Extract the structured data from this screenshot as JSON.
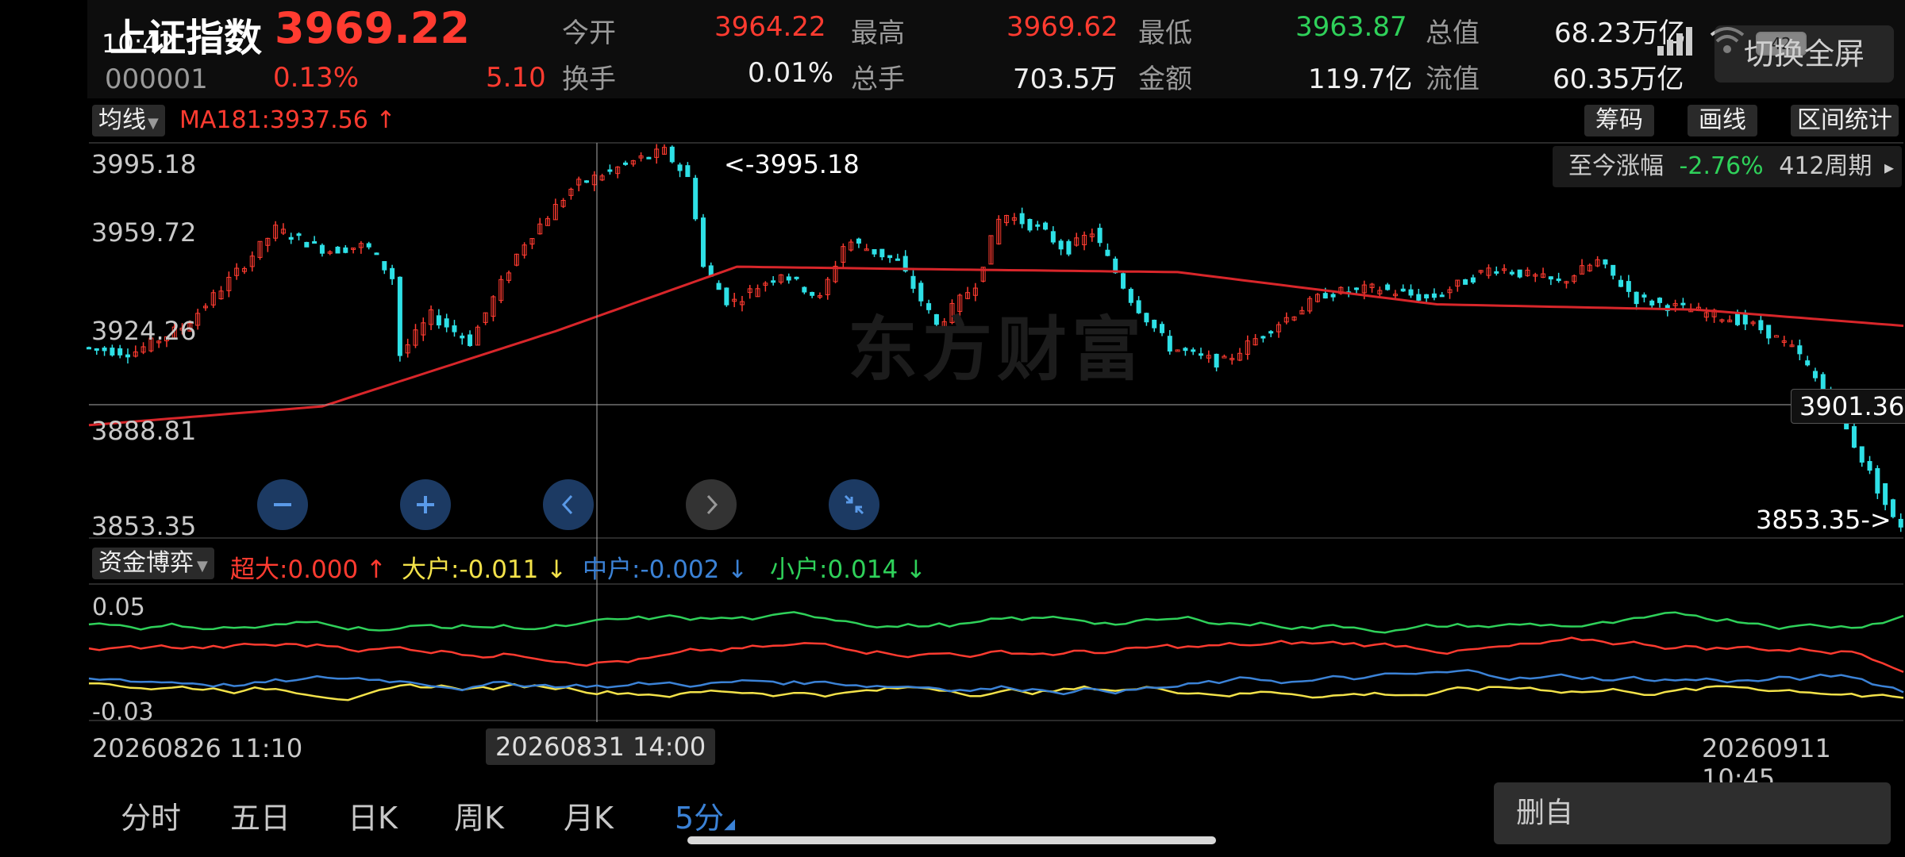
{
  "status_bar": {
    "time": "10:42",
    "battery": "42"
  },
  "header": {
    "name": "上证指数",
    "price": "3969.22",
    "code": "000001",
    "change_pct": "0.13%",
    "change_abs": "5.10",
    "switch_full_label": "切换全屏",
    "stats": [
      {
        "label": "今开",
        "value": "3964.22",
        "color": "#ff3b30"
      },
      {
        "label": "最高",
        "value": "3969.62",
        "color": "#ff3b30"
      },
      {
        "label": "最低",
        "value": "3963.87",
        "color": "#2fd15a"
      },
      {
        "label": "总值",
        "value": "68.23万亿",
        "color": "#f0f0f0"
      },
      {
        "label": "换手",
        "value": "0.01%",
        "color": "#f0f0f0"
      },
      {
        "label": "总手",
        "value": "703.5万",
        "color": "#f0f0f0"
      },
      {
        "label": "金额",
        "value": "119.7亿",
        "color": "#f0f0f0"
      },
      {
        "label": "流值",
        "value": "60.35万亿",
        "color": "#f0f0f0"
      }
    ]
  },
  "indicator_bar": {
    "selector": "均线",
    "ma_label": "MA181:3937.56 ↑",
    "buttons": [
      "筹码",
      "画线",
      "区间统计"
    ]
  },
  "main_chart": {
    "price_labels": [
      "3995.18",
      "3959.72",
      "3924.26",
      "3888.81",
      "3853.35"
    ],
    "period_change_label": "至今涨幅",
    "period_change_value": "-2.76%",
    "period_count": "412周期",
    "high_marker": "<-3995.18",
    "low_marker": "3853.35->",
    "crosshair_price": "3901.36",
    "watermark": "东方财富"
  },
  "fund_panel": {
    "selector": "资金博弈",
    "labels": [
      {
        "text": "超大:0.000 ↑",
        "color": "#ff3b30"
      },
      {
        "text": "大户:-0.011 ↓",
        "color": "#f3e24a"
      },
      {
        "text": "中户:-0.002 ↓",
        "color": "#3b82d6"
      },
      {
        "text": "小户:0.014 ↓",
        "color": "#2fd15a"
      }
    ],
    "axis_top": "0.05",
    "axis_bottom": "-0.03"
  },
  "time_axis": {
    "start": "20260826 11:10",
    "cursor": "20260831 14:00",
    "end": "20260911 10:45"
  },
  "bottom_tabs": {
    "items": [
      "分时",
      "五日",
      "日K",
      "周K",
      "月K",
      "5分"
    ],
    "active": "5分",
    "delete_label": "删自"
  },
  "chart_data": {
    "type": "candlestick",
    "y_ticks": [
      3995.18,
      3959.72,
      3924.26,
      3888.81,
      3853.35
    ],
    "ylim": [
      3853.35,
      3995.18
    ],
    "ma181_current": 3937.56,
    "period_high": 3995.18,
    "period_low": 3853.35,
    "period_change": "-2.76%",
    "periods": 412,
    "fund_flow": {
      "ylim": [
        -0.03,
        0.05
      ],
      "series": [
        {
          "name": "超大",
          "last": 0.0,
          "color": "#ff3b30"
        },
        {
          "name": "大户",
          "last": -0.011,
          "color": "#f3e24a"
        },
        {
          "name": "中户",
          "last": -0.002,
          "color": "#3b82d6"
        },
        {
          "name": "小户",
          "last": 0.014,
          "color": "#2fd15a"
        }
      ]
    }
  }
}
